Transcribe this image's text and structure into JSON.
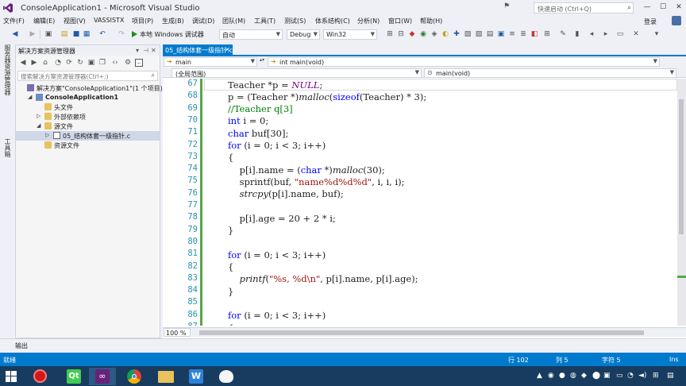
{
  "window": {
    "title": "ConsoleApplication1 - Microsoft Visual Studio",
    "quick_launch_placeholder": "快速启动 (Ctrl+Q)",
    "login": "登录"
  },
  "menu": [
    "文件(F)",
    "编辑(E)",
    "视图(V)",
    "VASSISTX",
    "项目(P)",
    "生成(B)",
    "调试(D)",
    "团队(M)",
    "工具(T)",
    "测试(S)",
    "体系结构(C)",
    "分析(N)",
    "窗口(W)",
    "帮助(H)"
  ],
  "toolbar": {
    "run_label": "本地 Windows 调试器",
    "run_config": "自动",
    "build_config": "Debug",
    "platform": "Win32"
  },
  "left_strip": {
    "server_explorer": "服务器资源管理器",
    "toolbox": "工具箱"
  },
  "solution_explorer": {
    "title": "解决方案资源管理器",
    "search_placeholder": "搜索解决方案资源管理器(Ctrl+;)",
    "tree": [
      {
        "label": "解决方案\"ConsoleApplication1\"(1 个项目)",
        "bold": false,
        "indent": 0,
        "arrow": "",
        "icon": "sln"
      },
      {
        "label": "ConsoleApplication1",
        "bold": true,
        "indent": 1,
        "arrow": "◢",
        "icon": "proj"
      },
      {
        "label": "头文件",
        "bold": false,
        "indent": 2,
        "arrow": "",
        "icon": "folder"
      },
      {
        "label": "外部依赖项",
        "bold": false,
        "indent": 2,
        "arrow": "▷",
        "icon": "folder"
      },
      {
        "label": "源文件",
        "bold": false,
        "indent": 2,
        "arrow": "◢",
        "icon": "folder"
      },
      {
        "label": "05_结构体套一级指针.c",
        "bold": false,
        "indent": 3,
        "arrow": "▷",
        "icon": "cfile",
        "selected": true
      },
      {
        "label": "资源文件",
        "bold": false,
        "indent": 2,
        "arrow": "",
        "icon": "folder"
      }
    ]
  },
  "editor": {
    "tab_name": "05_结构体套一级指针.c",
    "nav_left": "main",
    "nav_right": "int main(void)",
    "scope_left": "(全局范围)",
    "scope_right": "main(void)",
    "go_label": "Go",
    "zoom": "100 %",
    "lines": [
      {
        "num": "67",
        "code": "Teacher *p = NULL;"
      },
      {
        "num": "68",
        "code": "p = (Teacher *)malloc(sizeof(Teacher) * 3);"
      },
      {
        "num": "69",
        "code": "//Teacher q[3]"
      },
      {
        "num": "70",
        "code": "int i = 0;"
      },
      {
        "num": "71",
        "code": "char buf[30];"
      },
      {
        "num": "72",
        "code": "for (i = 0; i < 3; i++)"
      },
      {
        "num": "73",
        "code": "{"
      },
      {
        "num": "74",
        "code": "    p[i].name = (char *)malloc(30);"
      },
      {
        "num": "75",
        "code": "    sprintf(buf, \"name%d%d%d\", i, i, i);"
      },
      {
        "num": "76",
        "code": "    strcpy(p[i].name, buf);"
      },
      {
        "num": "77",
        "code": ""
      },
      {
        "num": "78",
        "code": "    p[i].age = 20 + 2 * i;"
      },
      {
        "num": "79",
        "code": "}"
      },
      {
        "num": "80",
        "code": ""
      },
      {
        "num": "81",
        "code": "for (i = 0; i < 3; i++)"
      },
      {
        "num": "82",
        "code": "{"
      },
      {
        "num": "83",
        "code": "    printf(\"%s, %d\\n\", p[i].name, p[i].age);"
      },
      {
        "num": "84",
        "code": "}"
      },
      {
        "num": "85",
        "code": ""
      },
      {
        "num": "86",
        "code": "for (i = 0; i < 3; i++)"
      },
      {
        "num": "87",
        "code": "{"
      }
    ]
  },
  "output_tab": "输出",
  "status": {
    "ready": "就绪",
    "line": "行 102",
    "col": "列 5",
    "char": "字符 5",
    "ins": "Ins"
  },
  "colors": {
    "accent": "#007acc",
    "taskbar": "#183c5f",
    "keyword": "#0000ff",
    "comment": "#008000",
    "string": "#a31515",
    "line_number": "#2b91af"
  }
}
